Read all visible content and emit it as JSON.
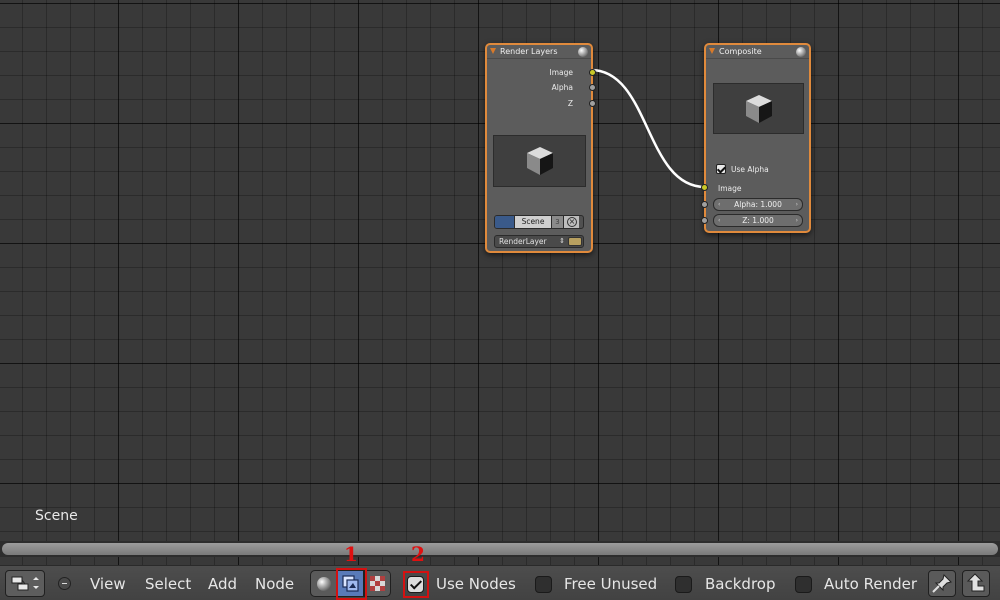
{
  "render_layers_node": {
    "title": "Render Layers",
    "outputs": [
      "Image",
      "Alpha",
      "Z"
    ],
    "scene_field": "Scene",
    "scene_users": "3",
    "layer_field": "RenderLayer",
    "layer_updown": "⇕"
  },
  "composite_node": {
    "title": "Composite",
    "use_alpha_label": "Use Alpha",
    "use_alpha_checked": true,
    "inputs": {
      "image": "Image",
      "alpha": "Alpha: 1.000",
      "z": "Z: 1.000"
    },
    "slider_left": "‹",
    "slider_right": "›"
  },
  "canvas": {
    "scene_label": "Scene"
  },
  "toolbar": {
    "menu": [
      "View",
      "Select",
      "Add",
      "Node"
    ],
    "tree_types": [
      "shader-tree-icon",
      "compositing-tree-icon",
      "texture-tree-icon"
    ],
    "active_tree_type": "compositing-tree-icon",
    "use_nodes_label": "Use Nodes",
    "use_nodes_checked": true,
    "free_unused_label": "Free Unused",
    "backdrop_label": "Backdrop",
    "auto_render_label": "Auto Render",
    "callouts": [
      "1",
      "2"
    ]
  },
  "colors": {
    "node_border": "#e08a3c",
    "link": "#ffffff",
    "socket_image": "#c8c829",
    "socket_value": "#a0a0a0",
    "callout": "#d41111",
    "active_toggle": "#597ab8"
  }
}
